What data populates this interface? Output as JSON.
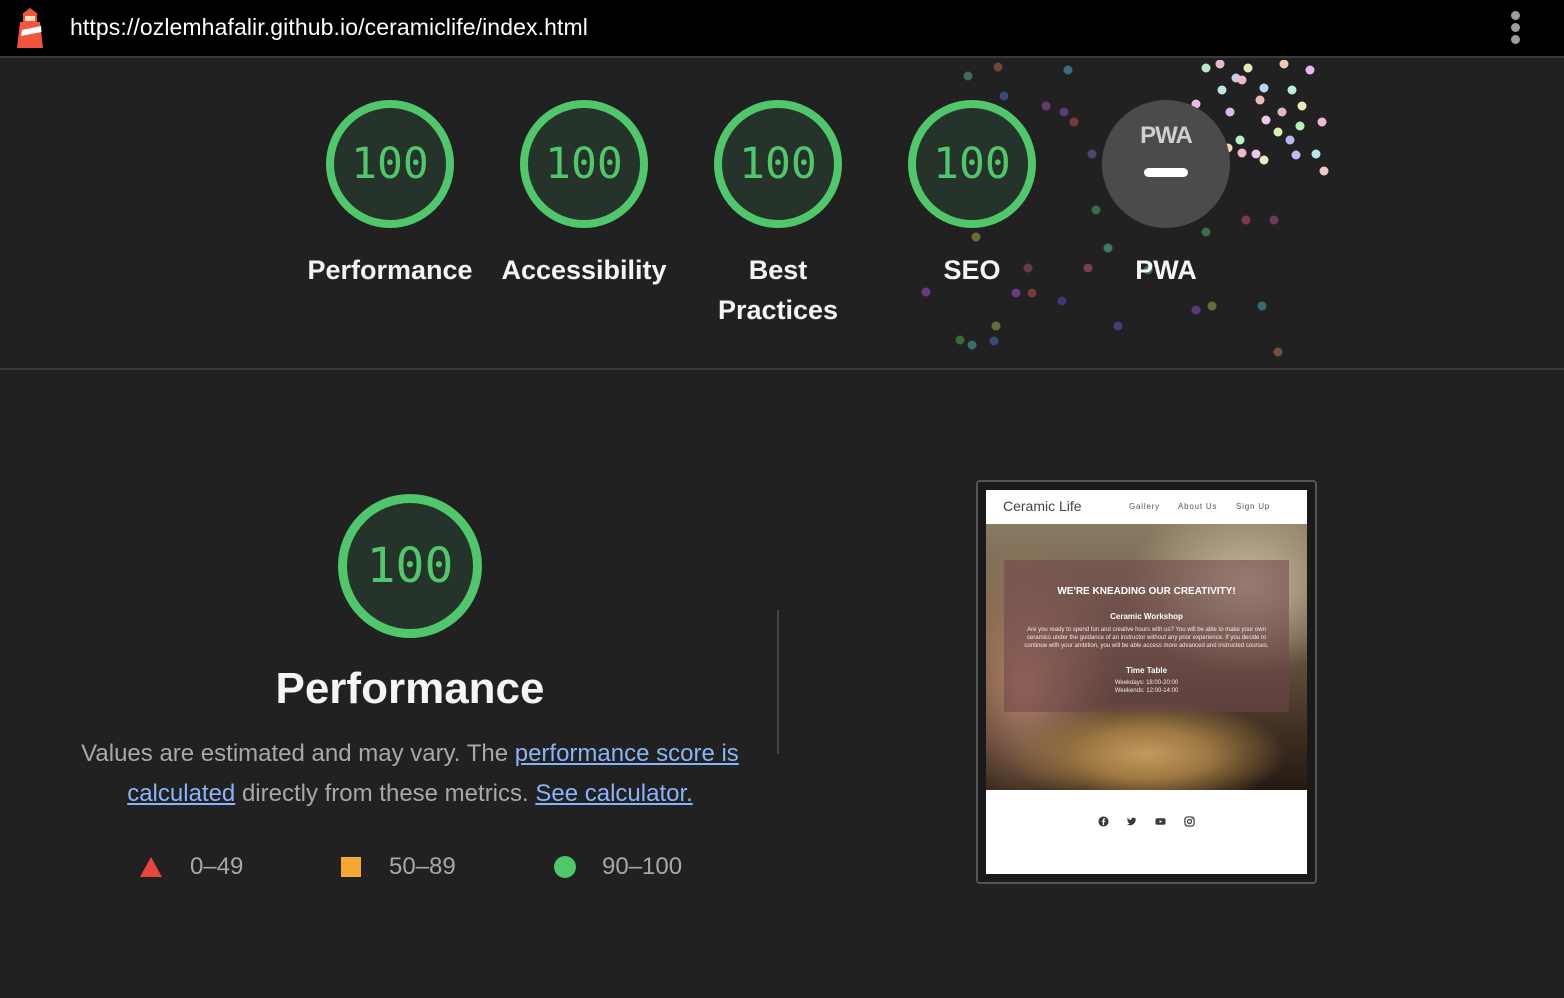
{
  "topbar": {
    "url": "https://ozlemhafalir.github.io/ceramiclife/index.html",
    "logo_icon": "lighthouse-icon",
    "menu_icon": "more-vertical-icon"
  },
  "categories": [
    {
      "label": "Performance",
      "score": "100"
    },
    {
      "label": "Accessibility",
      "score": "100"
    },
    {
      "label": "Best Practices",
      "score": "100"
    },
    {
      "label": "SEO",
      "score": "100"
    },
    {
      "label": "PWA",
      "score": "",
      "badge_text": "PWA",
      "badge_icon": "pwa-icon"
    }
  ],
  "performance": {
    "score": "100",
    "title": "Performance",
    "desc_intro": "Values are estimated and may vary. The ",
    "link_score": "performance score is calculated",
    "desc_mid": " directly from these metrics. ",
    "link_calc": "See calculator."
  },
  "legend": [
    {
      "range": "0–49",
      "shape": "triangle",
      "color": "#e8453c"
    },
    {
      "range": "50–89",
      "shape": "square",
      "color": "#f5a633"
    },
    {
      "range": "90–100",
      "shape": "circle",
      "color": "#4fc76a"
    }
  ],
  "thumbnail": {
    "brand": "Ceramic Life",
    "nav": [
      "Gallery",
      "About Us",
      "Sign Up"
    ],
    "heading": "WE'RE KNEADING OUR CREATIVITY!",
    "subheading": "Ceramic Workshop",
    "body": "Are you ready to spend fun and creative hours with us? You will be able to make your own ceramics under the guidance of an instructor without any prior experience. If you decide to continue with your ambition, you will be able access more advanced and instructed courses.",
    "timetable_title": "Time Table",
    "weekdays": "Weekdays: 18:00-20:00",
    "weekends": "Weekends: 12:00-14:00",
    "social_icons": [
      "facebook-icon",
      "twitter-icon",
      "youtube-icon",
      "instagram-icon"
    ]
  },
  "colors": {
    "pass": "#4fc76a",
    "background": "#212121",
    "link": "#8ab4f8"
  }
}
